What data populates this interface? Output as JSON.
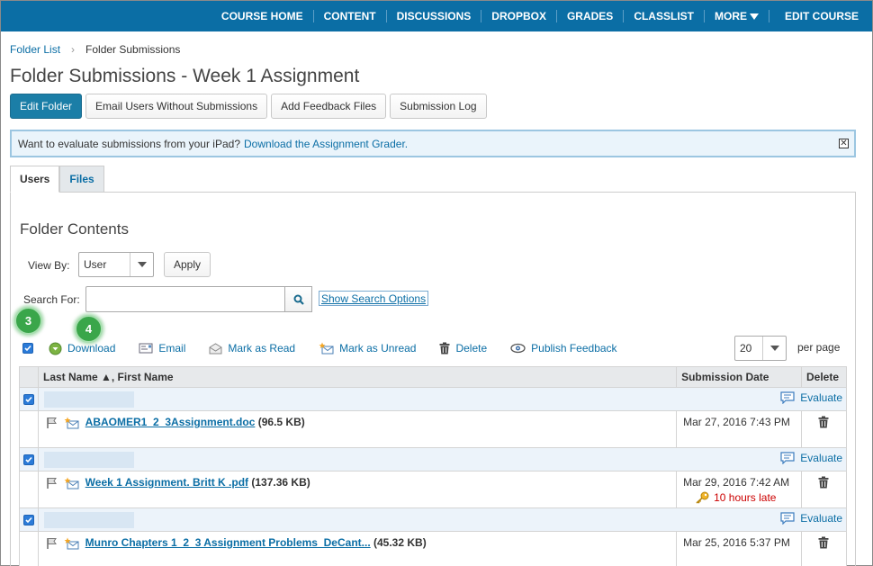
{
  "nav": {
    "items": [
      "COURSE HOME",
      "CONTENT",
      "DISCUSSIONS",
      "DROPBOX",
      "GRADES",
      "CLASSLIST",
      "MORE"
    ],
    "edit_course": "EDIT COURSE"
  },
  "breadcrumb": {
    "parent": "Folder List",
    "current": "Folder Submissions"
  },
  "page_title": "Folder Submissions - Week 1 Assignment",
  "buttons": {
    "edit_folder": "Edit Folder",
    "email_users": "Email Users Without Submissions",
    "add_feedback": "Add Feedback Files",
    "submission_log": "Submission Log"
  },
  "info_bar": {
    "text": "Want to evaluate submissions from your iPad?",
    "link": "Download the Assignment Grader."
  },
  "tabs": {
    "users": "Users",
    "files": "Files"
  },
  "section_title": "Folder Contents",
  "view_by": {
    "label": "View By:",
    "value": "User",
    "apply": "Apply"
  },
  "search": {
    "label": "Search For:",
    "value": "",
    "options_link": "Show Search Options"
  },
  "steps": {
    "a": "3",
    "b": "4"
  },
  "actions": {
    "download": "Download",
    "email": "Email",
    "mark_read": "Mark as Read",
    "mark_unread": "Mark as Unread",
    "delete": "Delete",
    "publish": "Publish Feedback"
  },
  "per_page": {
    "value": "20",
    "label": "per page"
  },
  "table": {
    "headers": {
      "name": "Last Name ▲, First Name",
      "date": "Submission Date",
      "delete": "Delete"
    },
    "evaluate": "Evaluate",
    "rows": [
      {
        "file": "ABAOMER1_2_3Assignment.doc",
        "size": "(96.5 KB)",
        "date": "Mar 27, 2016 7:43 PM",
        "late": ""
      },
      {
        "file": "Week 1 Assignment. Britt K .pdf",
        "size": "(137.36 KB)",
        "date": "Mar 29, 2016 7:42 AM",
        "late": "10 hours late"
      },
      {
        "file": "Munro Chapters 1_2_3 Assignment Problems_DeCant...",
        "size": "(45.32 KB)",
        "date": "Mar 25, 2016 5:37 PM",
        "late": ""
      }
    ]
  }
}
